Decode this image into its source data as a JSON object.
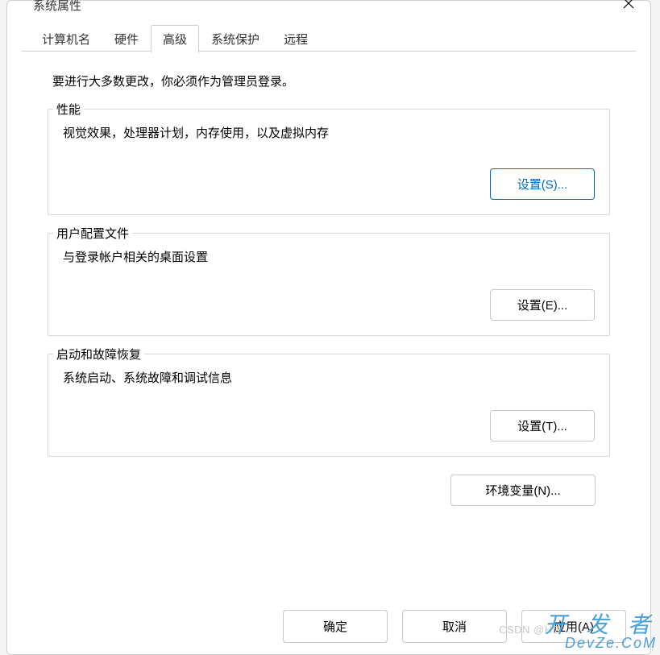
{
  "window": {
    "title": "系统属性"
  },
  "tabs": {
    "computer_name": "计算机名",
    "hardware": "硬件",
    "advanced": "高级",
    "system_protection": "系统保护",
    "remote": "远程"
  },
  "intro": "要进行大多数更改，你必须作为管理员登录。",
  "groups": {
    "performance": {
      "legend": "性能",
      "desc": "视觉效果，处理器计划，内存使用，以及虚拟内存",
      "button": "设置(S)..."
    },
    "user_profiles": {
      "legend": "用户配置文件",
      "desc": "与登录帐户相关的桌面设置",
      "button": "设置(E)..."
    },
    "startup_recovery": {
      "legend": "启动和故障恢复",
      "desc": "系统启动、系统故障和调试信息",
      "button": "设置(T)..."
    }
  },
  "env_button": "环境变量(N)...",
  "footer": {
    "ok": "确定",
    "cancel": "取消",
    "apply": "应用(A)"
  },
  "watermark": {
    "csdn": "CSDN @HD…",
    "devze_top": "开 发 者",
    "devze_bottom": "DevZe.CoM"
  }
}
